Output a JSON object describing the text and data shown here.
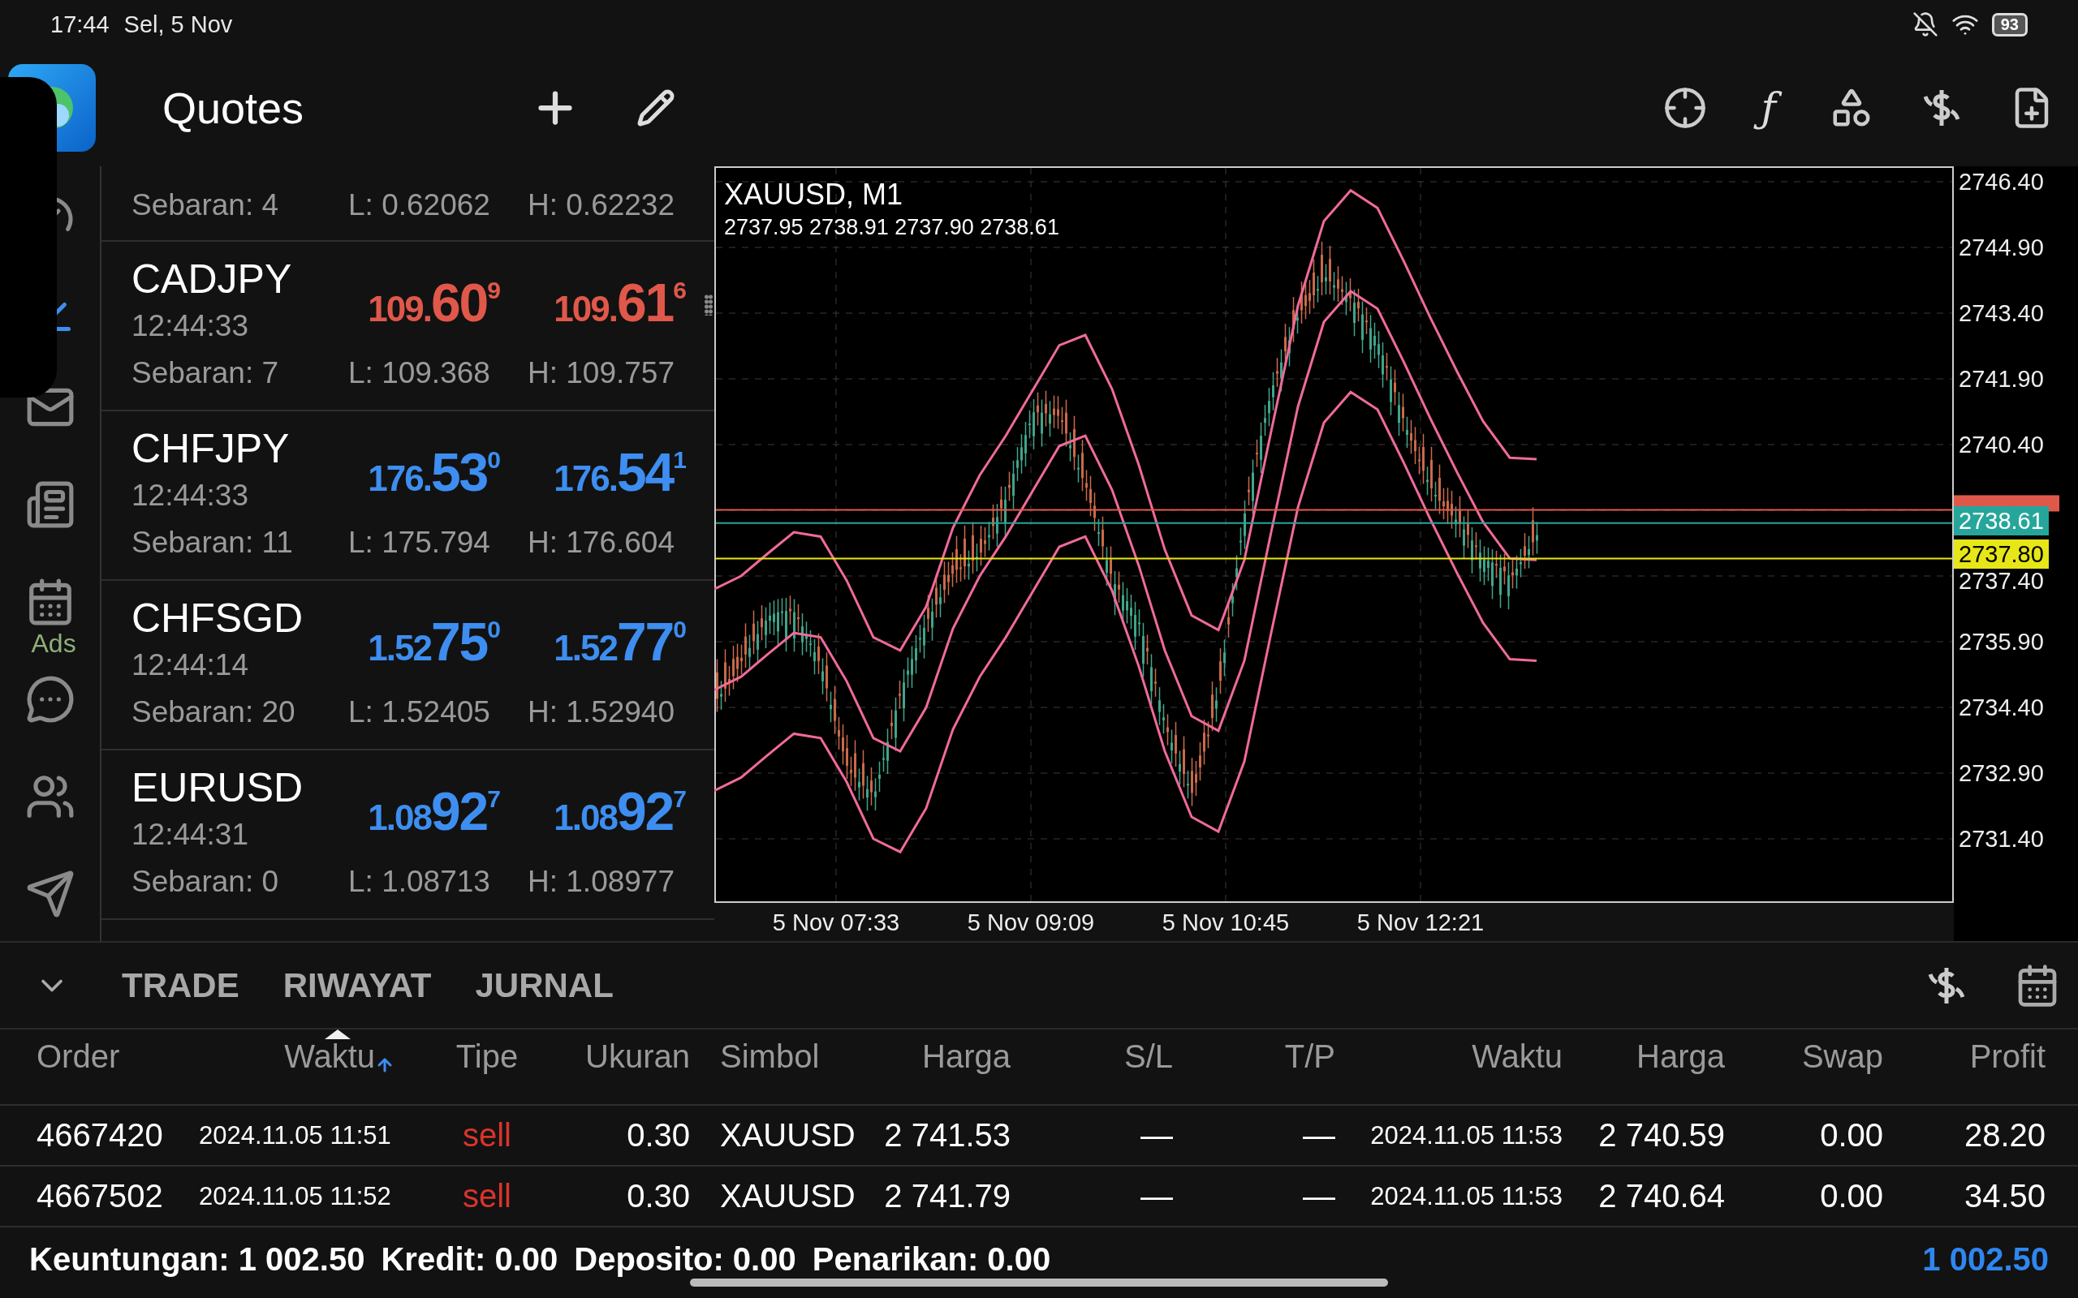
{
  "status_bar": {
    "time": "17:44",
    "date": "Sel, 5 Nov",
    "battery": "93"
  },
  "top_bar": {
    "title": "Quotes",
    "function_glyph": "ƒ"
  },
  "sidebar": {
    "ads_label": "Ads"
  },
  "quotes": {
    "partial_row": {
      "spread": "Sebaran: 4",
      "low": "L: 0.62062",
      "high": "H: 0.62232"
    },
    "rows": [
      {
        "symbol": "CADJPY",
        "time": "12:44:33",
        "color": "#e0584a",
        "bid": {
          "prefix": "109.",
          "big": "60",
          "sup": "9"
        },
        "ask": {
          "prefix": "109.",
          "big": "61",
          "sup": "6"
        },
        "spread": "Sebaran: 7",
        "low": "L: 109.368",
        "high": "H: 109.757"
      },
      {
        "symbol": "CHFJPY",
        "time": "12:44:33",
        "color": "#3d8ef0",
        "bid": {
          "prefix": "176.",
          "big": "53",
          "sup": "0"
        },
        "ask": {
          "prefix": "176.",
          "big": "54",
          "sup": "1"
        },
        "spread": "Sebaran: 11",
        "low": "L: 175.794",
        "high": "H: 176.604"
      },
      {
        "symbol": "CHFSGD",
        "time": "12:44:14",
        "color": "#3d8ef0",
        "bid": {
          "prefix": "1.52",
          "big": "75",
          "sup": "0"
        },
        "ask": {
          "prefix": "1.52",
          "big": "77",
          "sup": "0"
        },
        "spread": "Sebaran: 20",
        "low": "L: 1.52405",
        "high": "H: 1.52940"
      },
      {
        "symbol": "EURUSD",
        "time": "12:44:31",
        "color": "#3d8ef0",
        "bid": {
          "prefix": "1.08",
          "big": "92",
          "sup": "7"
        },
        "ask": {
          "prefix": "1.08",
          "big": "92",
          "sup": "7"
        },
        "spread": "Sebaran: 0",
        "low": "L: 1.08713",
        "high": "H: 1.08977"
      }
    ]
  },
  "chart": {
    "title": "XAUUSD, M1",
    "ohlc": "2737.95 2738.91 2737.90 2738.61",
    "y_labels": [
      "2746.40",
      "2744.90",
      "2743.40",
      "2741.90",
      "2740.40",
      "2737.40",
      "2735.90",
      "2734.40",
      "2732.90",
      "2731.40"
    ],
    "x_labels": [
      "5 Nov 07:33",
      "5 Nov 09:09",
      "5 Nov 10:45",
      "5 Nov 12:21"
    ],
    "price_tags": [
      {
        "text": "2738.61",
        "color": "#26a69a"
      },
      {
        "text": "2737.80",
        "color": "#e6e619"
      }
    ]
  },
  "bottom": {
    "tabs": [
      "TRADE",
      "RIWAYAT",
      "JURNAL"
    ],
    "columns": [
      {
        "label": "Order",
        "sorted": false
      },
      {
        "label": "Waktu",
        "sorted": true
      },
      {
        "label": "Tipe",
        "sorted": false
      },
      {
        "label": "Ukuran",
        "sorted": false
      },
      {
        "label": "Simbol",
        "sorted": false
      },
      {
        "label": "Harga",
        "sorted": false
      },
      {
        "label": "S/L",
        "sorted": false
      },
      {
        "label": "T/P",
        "sorted": false
      },
      {
        "label": "Waktu",
        "sorted": false
      },
      {
        "label": "Harga",
        "sorted": false
      },
      {
        "label": "Swap",
        "sorted": false
      },
      {
        "label": "Profit",
        "sorted": false
      }
    ],
    "rows": [
      [
        "4667420",
        "2024.11.05 11:51",
        "sell",
        "0.30",
        "XAUUSD",
        "2 741.53",
        "—",
        "—",
        "2024.11.05 11:53",
        "2 740.59",
        "0.00",
        "28.20"
      ],
      [
        "4667502",
        "2024.11.05 11:52",
        "sell",
        "0.30",
        "XAUUSD",
        "2 741.79",
        "—",
        "—",
        "2024.11.05 11:53",
        "2 740.64",
        "0.00",
        "34.50"
      ]
    ],
    "summary": [
      "Keuntungan: 1 002.50",
      "Kredit: 0.00",
      "Deposito: 0.00",
      "Penarikan: 0.00"
    ],
    "total": "1 002.50"
  }
}
